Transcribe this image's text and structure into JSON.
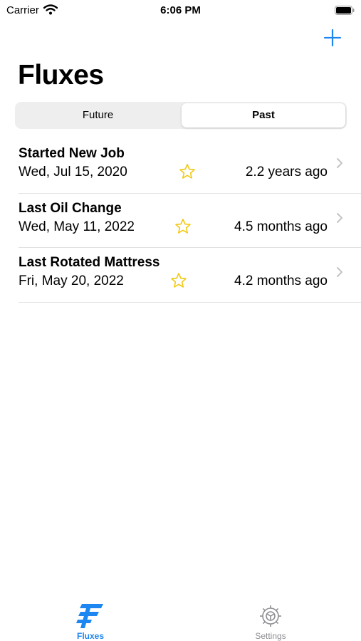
{
  "status_bar": {
    "carrier": "Carrier",
    "time": "6:06 PM"
  },
  "header": {
    "title": "Fluxes",
    "add_icon": "plus-icon"
  },
  "segments": [
    {
      "label": "Future",
      "selected": false
    },
    {
      "label": "Past",
      "selected": true
    }
  ],
  "fluxes": [
    {
      "title": "Started New Job",
      "date": "Wed, Jul 15, 2020",
      "ago": "2.2 years ago",
      "favorite": false
    },
    {
      "title": "Last Oil Change",
      "date": "Wed, May 11, 2022",
      "ago": "4.5 months ago",
      "favorite": false
    },
    {
      "title": "Last Rotated Mattress",
      "date": "Fri, May 20, 2022",
      "ago": "4.2 months ago",
      "favorite": false
    }
  ],
  "tabs": [
    {
      "label": "Fluxes",
      "icon": "fluxes-logo-icon",
      "selected": true
    },
    {
      "label": "Settings",
      "icon": "gear-icon",
      "selected": false
    }
  ],
  "colors": {
    "accent": "#1e86f0",
    "star": "#f2c811",
    "inactive": "#8e8e93"
  }
}
